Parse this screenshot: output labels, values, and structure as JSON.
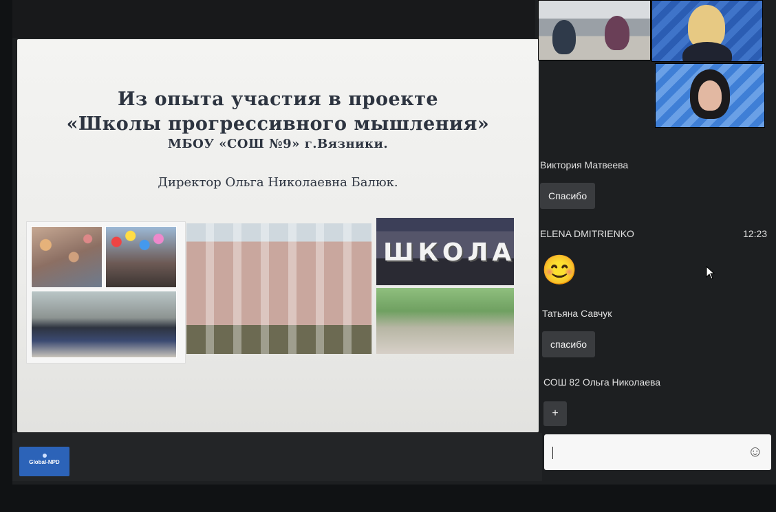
{
  "slide": {
    "title_line1": "Из опыта участия в проекте",
    "title_line2": "«Школы прогрессивного мышления»",
    "school": "МБОУ «СОШ №9» г.Вязники.",
    "director": "Директор Ольга Николаевна Балюк.",
    "photo_word": "ШКОЛА"
  },
  "logo": {
    "name": "Global-NPD"
  },
  "chat": {
    "messages": [
      {
        "author": "Виктория Матвеева",
        "text": "Спасибо",
        "time": ""
      },
      {
        "author": "ELENA DMITRIENKO",
        "text": "😊",
        "time": "12:23"
      },
      {
        "author": "Татьяна Савчук",
        "text": "спасибо",
        "time": ""
      },
      {
        "author": "СОШ 82 Ольга Николаева",
        "text": "+",
        "time": ""
      }
    ],
    "input_value": "",
    "emoji_button_icon": "☺"
  },
  "colors": {
    "background": "#1d1f21",
    "bubble": "#3a3c3f",
    "logo": "#2c63b8"
  }
}
